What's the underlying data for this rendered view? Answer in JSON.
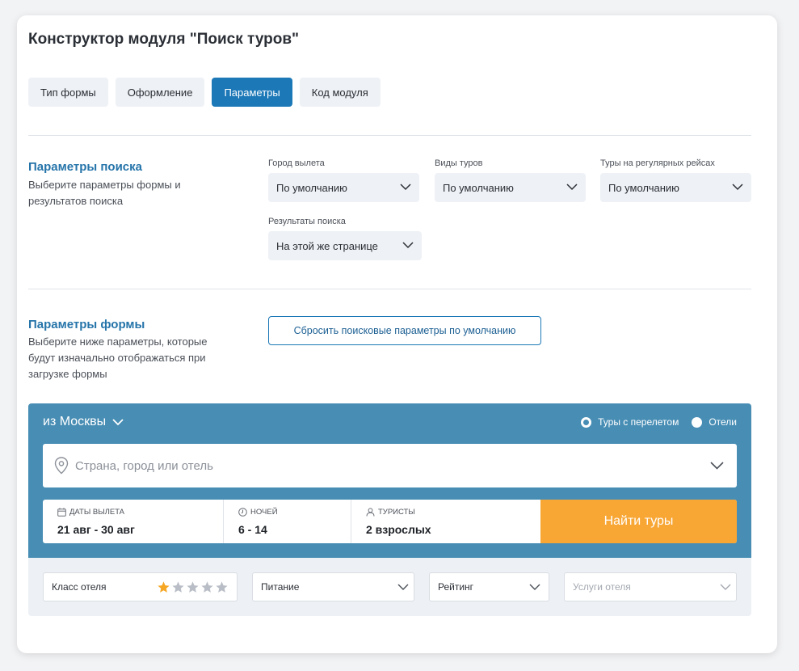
{
  "title": "Конструктор модуля \"Поиск туров\"",
  "tabs": [
    {
      "label": "Тип формы",
      "active": false
    },
    {
      "label": "Оформление",
      "active": false
    },
    {
      "label": "Параметры",
      "active": true
    },
    {
      "label": "Код модуля",
      "active": false
    }
  ],
  "search_params": {
    "title": "Параметры поиска",
    "desc": "Выберите параметры формы и результатов поиска",
    "fields": [
      {
        "label": "Город вылета",
        "value": "По умолчанию"
      },
      {
        "label": "Виды туров",
        "value": "По умолчанию"
      },
      {
        "label": "Туры на регулярных рейсах",
        "value": "По умолчанию"
      },
      {
        "label": "Результаты поиска",
        "value": "На этой же странице"
      }
    ]
  },
  "form_params": {
    "title": "Параметры формы",
    "desc": "Выберите ниже параметры, которые будут изначально отображаться при загрузке формы",
    "reset_label": "Сбросить поисковые параметры по умолчанию"
  },
  "widget": {
    "city": "из Москвы",
    "radio_flight": "Туры с перелетом",
    "radio_hotels": "Отели",
    "search_placeholder": "Страна, город или отель",
    "dates_label": "Даты вылета",
    "dates_value": "21 авг - 30 авг",
    "nights_label": "Ночей",
    "nights_value": "6 - 14",
    "tourists_label": "Туристы",
    "tourists_value": "2 взрослых",
    "find_label": "Найти туры",
    "hotel_class_label": "Класс отеля",
    "hotel_class_rating": 1,
    "hotel_class_max": 5,
    "meal_label": "Питание",
    "rating_label": "Рейтинг",
    "services_label": "Услуги отеля"
  },
  "colors": {
    "accent": "#1c78b7",
    "widget_bg": "#478db4",
    "button_orange": "#f8a634",
    "star_on": "#f5a623",
    "star_off": "#b9bec6"
  }
}
